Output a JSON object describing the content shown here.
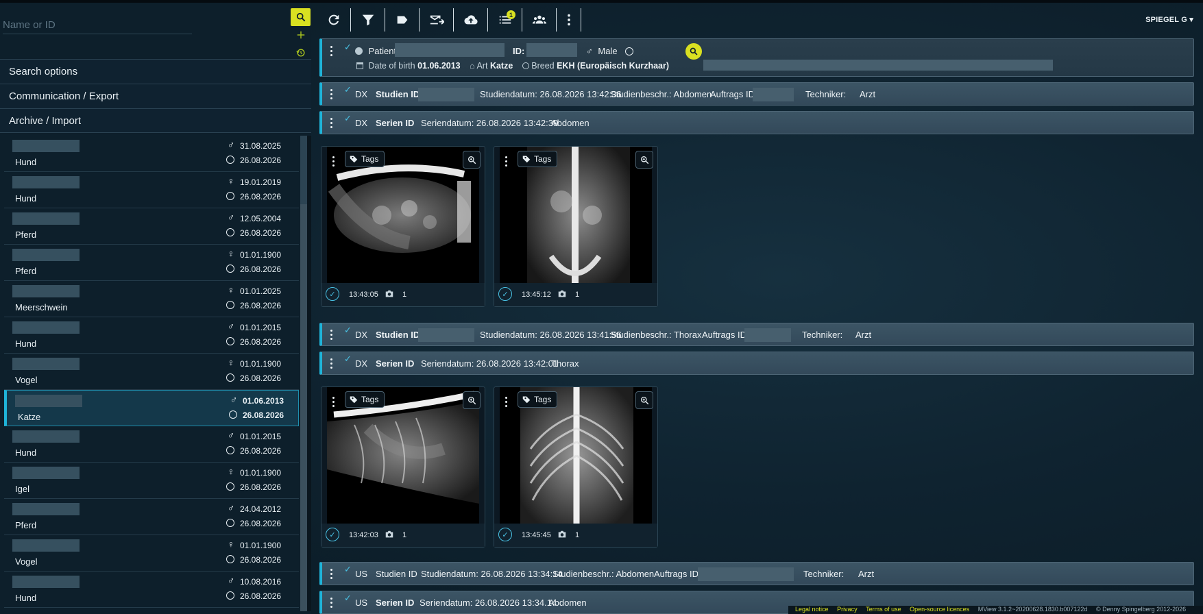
{
  "search": {
    "placeholder": "Name or ID"
  },
  "accordion": [
    "Search options",
    "Communication / Export",
    "Archive / Import"
  ],
  "patients": [
    {
      "sex": "♂",
      "birth": "31.08.2025",
      "study": "26.08.2026",
      "species": "Hund"
    },
    {
      "sex": "♀",
      "birth": "19.01.2019",
      "study": "26.08.2026",
      "species": "Hund"
    },
    {
      "sex": "♂",
      "birth": "12.05.2004",
      "study": "26.08.2026",
      "species": "Pferd"
    },
    {
      "sex": "♀",
      "birth": "01.01.1900",
      "study": "26.08.2026",
      "species": "Pferd"
    },
    {
      "sex": "♀",
      "birth": "01.01.2025",
      "study": "26.08.2026",
      "species": "Meerschwein"
    },
    {
      "sex": "♂",
      "birth": "01.01.2015",
      "study": "26.08.2026",
      "species": "Hund"
    },
    {
      "sex": "♀",
      "birth": "01.01.1900",
      "study": "26.08.2026",
      "species": "Vogel"
    },
    {
      "sex": "♂",
      "birth": "01.06.2013",
      "study": "26.08.2026",
      "species": "Katze",
      "selected": true
    },
    {
      "sex": "♂",
      "birth": "01.01.2015",
      "study": "26.08.2026",
      "species": "Hund"
    },
    {
      "sex": "♀",
      "birth": "01.01.1900",
      "study": "26.08.2026",
      "species": "Igel"
    },
    {
      "sex": "♂",
      "birth": "24.04.2012",
      "study": "26.08.2026",
      "species": "Pferd"
    },
    {
      "sex": "♀",
      "birth": "01.01.1900",
      "study": "26.08.2026",
      "species": "Vogel"
    },
    {
      "sex": "♂",
      "birth": "10.08.2016",
      "study": "26.08.2026",
      "species": "Hund"
    }
  ],
  "toolbar": {
    "badge": "1",
    "user": "SPIEGEL G"
  },
  "patient": {
    "patient_label": "Patient",
    "id_label": "ID:",
    "sex_symbol": "♂",
    "sex": "Male",
    "dob_label": "Date of birth",
    "dob": "01.06.2013",
    "art_label": "Art",
    "art": "Katze",
    "breed_label": "Breed",
    "breed": "EKH (Europäisch Kurzhaar)"
  },
  "studies": [
    {
      "modality": "DX",
      "study_id_label": "Studien ID",
      "date_text": "Studiendatum: 26.08.2026 13:42:36",
      "desc_text": "Studienbeschr.: Abdomen",
      "order_label": "Auftrags ID:",
      "tech_label": "Techniker:",
      "doctor_label": "Arzt",
      "series": {
        "modality": "DX",
        "series_id_label": "Serien ID",
        "date_text": "Seriendatum: 26.08.2026 13:42:39",
        "body_part": "Abdomen"
      },
      "thumbs": [
        {
          "tag": "Tags",
          "time": "13:43:05",
          "count": "1"
        },
        {
          "tag": "Tags",
          "time": "13:45:12",
          "count": "1"
        }
      ]
    },
    {
      "modality": "DX",
      "study_id_label": "Studien ID",
      "date_text": "Studiendatum: 26.08.2026 13:41:56",
      "desc_text": "Studienbeschr.: Thorax",
      "order_label": "Auftrags ID:",
      "tech_label": "Techniker:",
      "doctor_label": "Arzt",
      "series": {
        "modality": "DX",
        "series_id_label": "Serien ID",
        "date_text": "Seriendatum: 26.08.2026 13:42:01",
        "body_part": "Thorax"
      },
      "thumbs": [
        {
          "tag": "Tags",
          "time": "13:42:03",
          "count": "1"
        },
        {
          "tag": "Tags",
          "time": "13:45:45",
          "count": "1"
        }
      ]
    },
    {
      "modality": "US",
      "study_id_label": "Studien ID",
      "date_text": "Studiendatum: 26.08.2026 13:34:14",
      "desc_text": "Studienbeschr.: Abdomen",
      "order_label": "Auftrags ID:",
      "tech_label": "Techniker:",
      "doctor_label": "Arzt",
      "series": {
        "modality": "US",
        "series_id_label": "Serien ID",
        "date_text": "Seriendatum: 26.08.2026 13:34.14",
        "body_part": "Abdomen"
      }
    }
  ],
  "footer": {
    "legal": "Legal notice",
    "privacy": "Privacy",
    "terms": "Terms of use",
    "oss": "Open-source licences",
    "version": "MView 3.1.2~20200628.1830.b007122d",
    "copyright": "© Denny Spingelberg 2012-2026"
  },
  "colors": {
    "accent": "#d9e021",
    "highlight": "#1fb4d9",
    "check": "#49c3e6"
  }
}
